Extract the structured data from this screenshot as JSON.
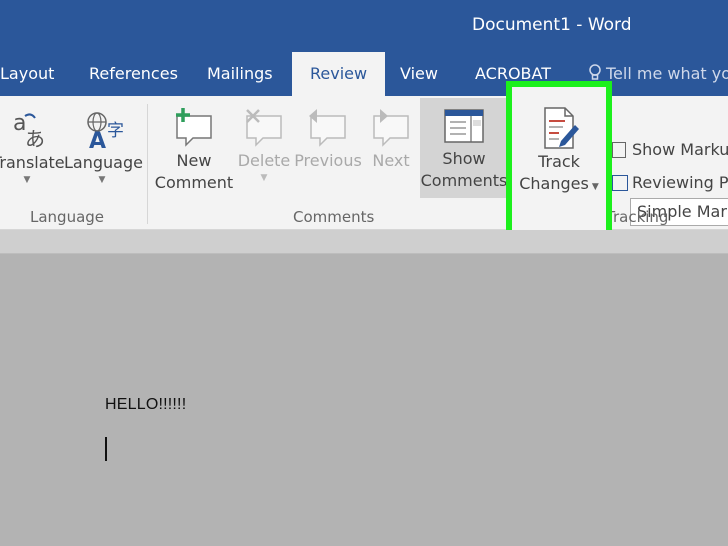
{
  "window": {
    "title": "Document1  -  Word"
  },
  "tabs": [
    {
      "label": "Layout"
    },
    {
      "label": "References"
    },
    {
      "label": "Mailings"
    },
    {
      "label": "Review",
      "active": true
    },
    {
      "label": "View"
    },
    {
      "label": "ACROBAT"
    }
  ],
  "tell_me": {
    "text": "Tell me what yo"
  },
  "ribbon": {
    "language_group": {
      "label": "Language",
      "translate": "Translate",
      "language": "Language"
    },
    "comments_group": {
      "label": "Comments",
      "new_comment_line1": "New",
      "new_comment_line2": "Comment",
      "delete": "Delete",
      "previous": "Previous",
      "next": "Next",
      "show_comments_line1": "Show",
      "show_comments_line2": "Comments"
    },
    "tracking_group": {
      "label": "Tracking",
      "track_changes_line1": "Track",
      "track_changes_line2": "Changes",
      "markup_select": "Simple Markup",
      "show_markup": "Show Markup",
      "reviewing_pane": "Reviewing Pane"
    }
  },
  "document": {
    "text": "HELLO!!!!!!"
  },
  "colors": {
    "title_bar": "#2b579a",
    "ribbon_bg": "#f3f3f3",
    "highlight": "#1cf01c",
    "doc_bg": "#b3b3b3"
  }
}
